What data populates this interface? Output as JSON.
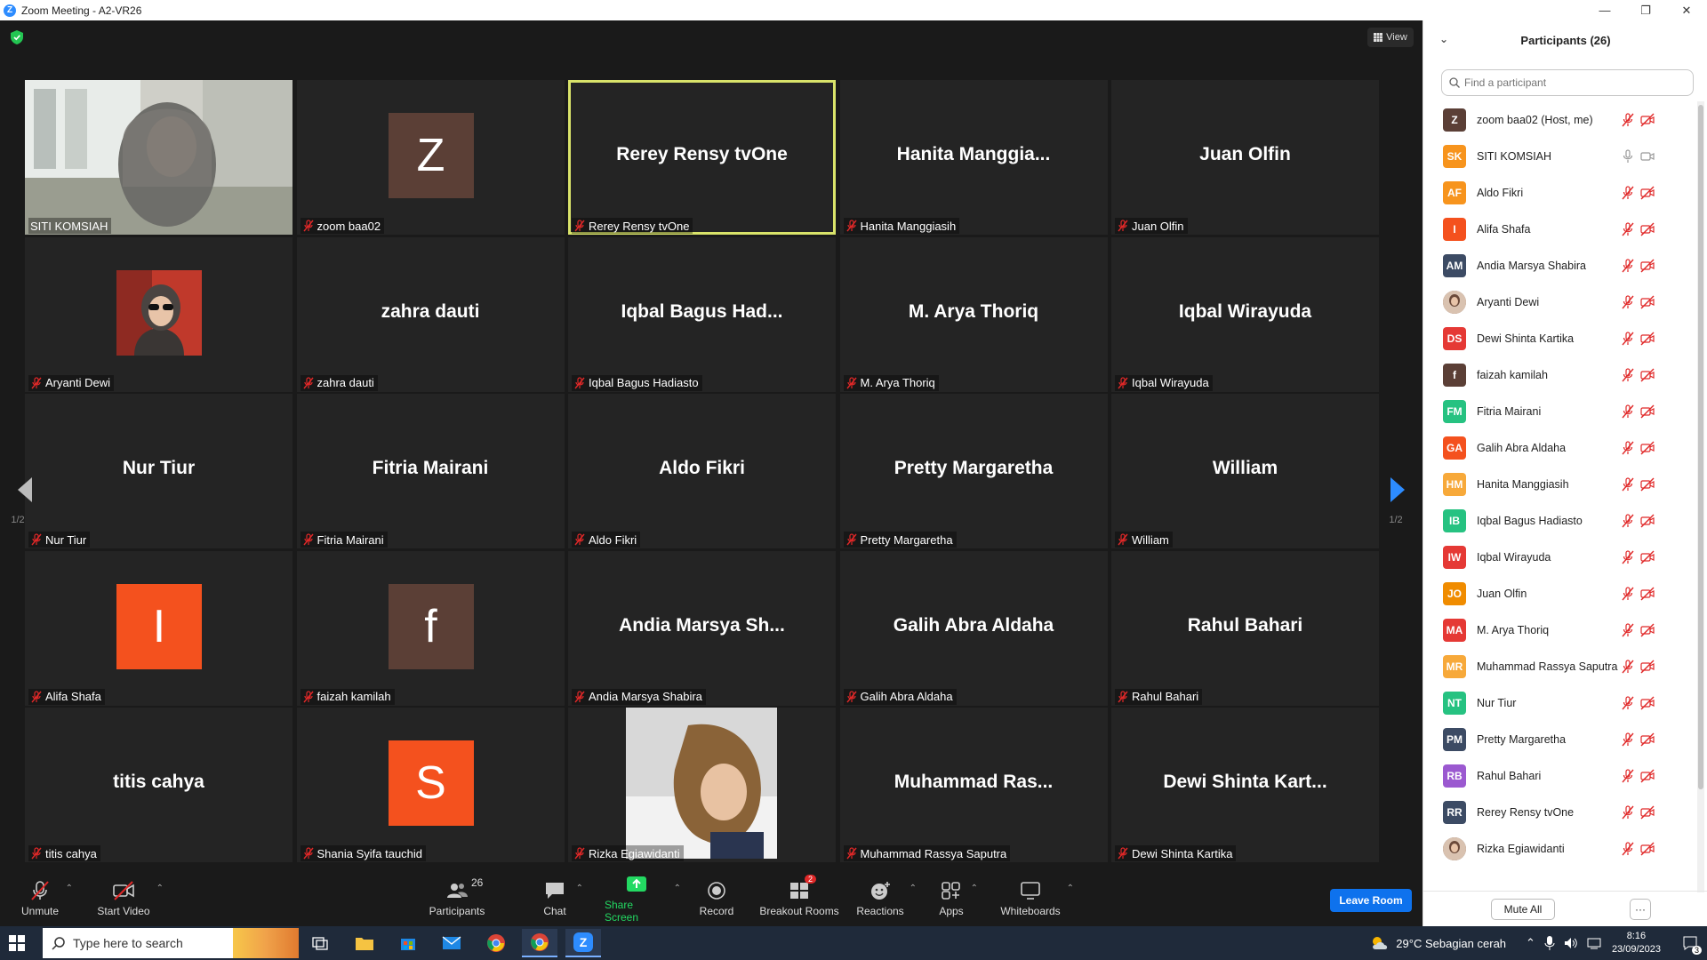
{
  "window": {
    "title": "Zoom Meeting - A2-VR26",
    "logo_letter": "Z"
  },
  "meeting": {
    "view_label": "View",
    "page_indicator": "1/2",
    "tiles": [
      {
        "display": "",
        "label": "SITI KOMSIAH",
        "kind": "video",
        "active": false
      },
      {
        "display": "",
        "label": "zoom baa02",
        "kind": "avatar",
        "avatar_letter": "Z",
        "avatar_color": "#5b3f36",
        "active": false
      },
      {
        "display": "Rerey Rensy tvOne",
        "label": "Rerey Rensy tvOne",
        "kind": "name",
        "active": true
      },
      {
        "display": "Hanita  Manggia...",
        "label": "Hanita Manggiasih",
        "kind": "name",
        "active": false
      },
      {
        "display": "Juan Olfin",
        "label": "Juan Olfin",
        "kind": "name",
        "active": false
      },
      {
        "display": "",
        "label": "Aryanti Dewi",
        "kind": "photo",
        "active": false
      },
      {
        "display": "zahra dauti",
        "label": "zahra dauti",
        "kind": "name",
        "active": false
      },
      {
        "display": "Iqbal Bagus Had...",
        "label": "Iqbal Bagus Hadiasto",
        "kind": "name",
        "active": false
      },
      {
        "display": "M. Arya Thoriq",
        "label": "M. Arya Thoriq",
        "kind": "name",
        "active": false
      },
      {
        "display": "Iqbal Wirayuda",
        "label": "Iqbal Wirayuda",
        "kind": "name",
        "active": false
      },
      {
        "display": "Nur Tiur",
        "label": "Nur Tiur",
        "kind": "name",
        "active": false
      },
      {
        "display": "Fitria Mairani",
        "label": "Fitria Mairani",
        "kind": "name",
        "active": false
      },
      {
        "display": "Aldo Fikri",
        "label": "Aldo Fikri",
        "kind": "name",
        "active": false
      },
      {
        "display": "Pretty Margaretha",
        "label": "Pretty Margaretha",
        "kind": "name",
        "active": false
      },
      {
        "display": "William",
        "label": "William",
        "kind": "name",
        "active": false
      },
      {
        "display": "",
        "label": "Alifa Shafa",
        "kind": "avatar",
        "avatar_letter": "I",
        "avatar_color": "#f4511e",
        "active": false
      },
      {
        "display": "",
        "label": "faizah kamilah",
        "kind": "avatar",
        "avatar_letter": "f",
        "avatar_color": "#5b3f36",
        "active": false
      },
      {
        "display": "Andia Marsya Sh...",
        "label": "Andia Marsya Shabira",
        "kind": "name",
        "active": false
      },
      {
        "display": "Galih Abra Aldaha",
        "label": "Galih Abra Aldaha",
        "kind": "name",
        "active": false
      },
      {
        "display": "Rahul Bahari",
        "label": "Rahul Bahari",
        "kind": "name",
        "active": false
      },
      {
        "display": "titis cahya",
        "label": "titis cahya",
        "kind": "name",
        "active": false
      },
      {
        "display": "",
        "label": "Shania Syifa tauchid",
        "kind": "avatar",
        "avatar_letter": "S",
        "avatar_color": "#f4511e",
        "active": false
      },
      {
        "display": "",
        "label": "Rizka Egiawidanti",
        "kind": "bigphoto",
        "active": false
      },
      {
        "display": "Muhammad  Ras...",
        "label": "Muhammad Rassya Saputra",
        "kind": "name",
        "active": false
      },
      {
        "display": "Dewi Shinta Kart...",
        "label": "Dewi Shinta Kartika",
        "kind": "name",
        "active": false
      }
    ]
  },
  "toolbar": {
    "unmute": "Unmute",
    "start_video": "Start Video",
    "participants": "Participants",
    "participants_count": "26",
    "chat": "Chat",
    "share_screen": "Share Screen",
    "record": "Record",
    "breakout_rooms": "Breakout Rooms",
    "breakout_badge": "2",
    "reactions": "Reactions",
    "apps": "Apps",
    "whiteboards": "Whiteboards",
    "leave": "Leave Room"
  },
  "panel": {
    "title": "Participants (26)",
    "search_placeholder": "Find a participant",
    "mute_all": "Mute All",
    "more": "···",
    "participants": [
      {
        "initials": "Z",
        "name": "zoom baa02 (Host, me)",
        "color": "#5b3f36",
        "muted": true,
        "video_off": true
      },
      {
        "initials": "SK",
        "name": "SITI KOMSIAH",
        "color": "#f7941d",
        "muted": false,
        "video_off": false
      },
      {
        "initials": "AF",
        "name": "Aldo Fikri",
        "color": "#f7941d",
        "muted": true,
        "video_off": true
      },
      {
        "initials": "I",
        "name": "Alifa Shafa",
        "color": "#f4511e",
        "muted": true,
        "video_off": true
      },
      {
        "initials": "AM",
        "name": "Andia Marsya Shabira",
        "color": "#3c4b64",
        "muted": true,
        "video_off": true
      },
      {
        "initials": "",
        "name": "Aryanti Dewi",
        "color": "#8a5a44",
        "muted": true,
        "video_off": true,
        "photo": true
      },
      {
        "initials": "DS",
        "name": "Dewi Shinta Kartika",
        "color": "#e53935",
        "muted": true,
        "video_off": true
      },
      {
        "initials": "f",
        "name": "faizah kamilah",
        "color": "#5b3f36",
        "muted": true,
        "video_off": true
      },
      {
        "initials": "FM",
        "name": "Fitria Mairani",
        "color": "#26c281",
        "muted": true,
        "video_off": true
      },
      {
        "initials": "GA",
        "name": "Galih Abra Aldaha",
        "color": "#f4511e",
        "muted": true,
        "video_off": true
      },
      {
        "initials": "HM",
        "name": "Hanita Manggiasih",
        "color": "#f7a93a",
        "muted": true,
        "video_off": true
      },
      {
        "initials": "IB",
        "name": "Iqbal Bagus Hadiasto",
        "color": "#26c281",
        "muted": true,
        "video_off": true
      },
      {
        "initials": "IW",
        "name": "Iqbal Wirayuda",
        "color": "#e53935",
        "muted": true,
        "video_off": true
      },
      {
        "initials": "JO",
        "name": "Juan Olfin",
        "color": "#f08c00",
        "muted": true,
        "video_off": true
      },
      {
        "initials": "MA",
        "name": "M. Arya Thoriq",
        "color": "#e53935",
        "muted": true,
        "video_off": true
      },
      {
        "initials": "MR",
        "name": "Muhammad Rassya Saputra",
        "color": "#f7a93a",
        "muted": true,
        "video_off": true
      },
      {
        "initials": "NT",
        "name": "Nur Tiur",
        "color": "#26c281",
        "muted": true,
        "video_off": true
      },
      {
        "initials": "PM",
        "name": "Pretty Margaretha",
        "color": "#3c4b64",
        "muted": true,
        "video_off": true
      },
      {
        "initials": "RB",
        "name": "Rahul Bahari",
        "color": "#9b59d0",
        "muted": true,
        "video_off": true
      },
      {
        "initials": "RR",
        "name": "Rerey Rensy tvOne",
        "color": "#3c4b64",
        "muted": true,
        "video_off": true
      },
      {
        "initials": "",
        "name": "Rizka Egiawidanti",
        "color": "#6b4a3a",
        "muted": true,
        "video_off": true,
        "photo": true
      }
    ]
  },
  "taskbar": {
    "search_placeholder": "Type here to search",
    "weather": "29°C  Sebagian cerah",
    "time": "8:16",
    "date": "23/09/2023",
    "notification_count": "3"
  },
  "colors": {
    "accent_blue": "#0e72ed",
    "active_speaker": "#d9e36a",
    "muted_red": "#e02828",
    "share_green": "#23d962"
  }
}
